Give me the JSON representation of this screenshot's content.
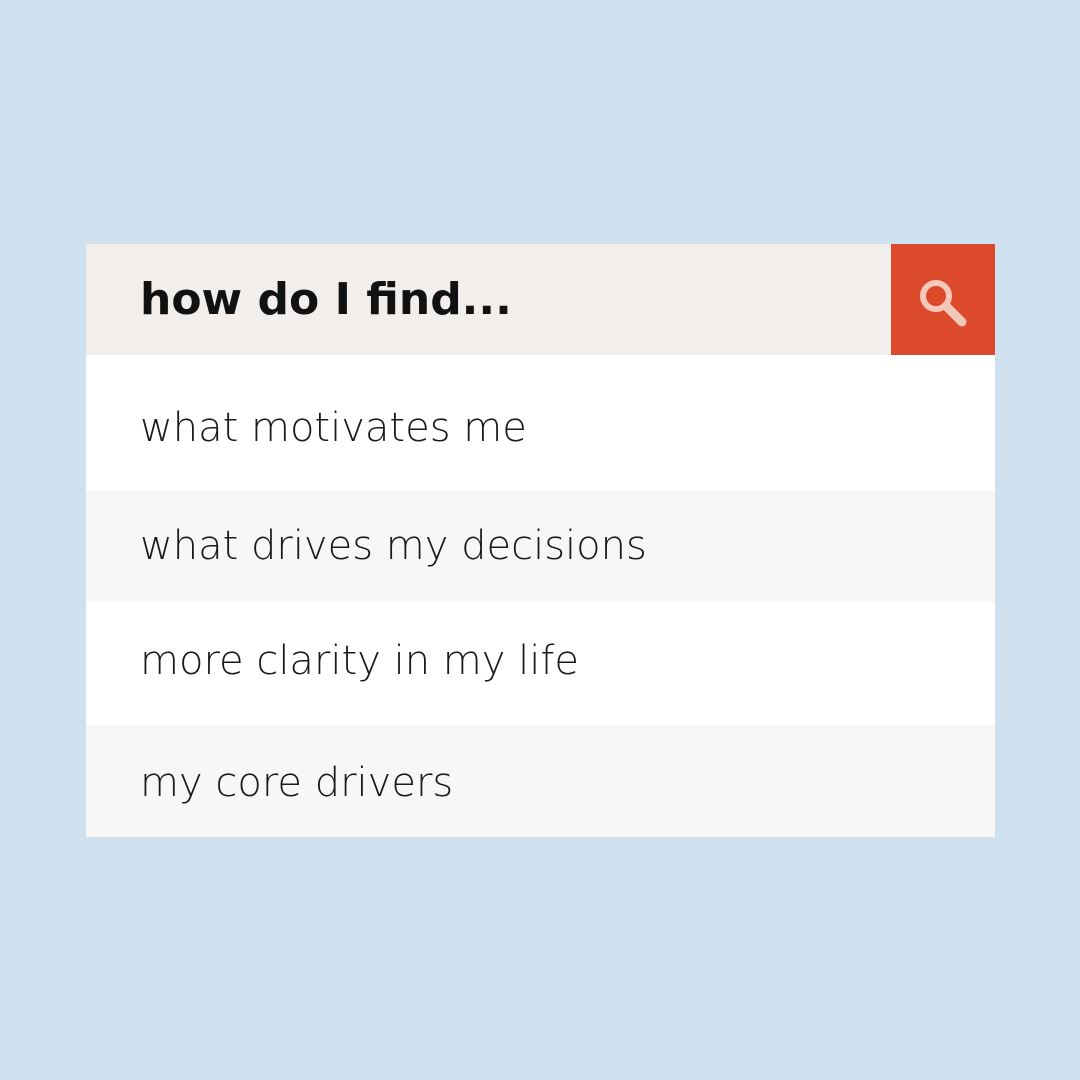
{
  "search": {
    "query": "how do I find...",
    "button_icon": "magnifier-icon",
    "button_color": "#dc4a2b"
  },
  "suggestions": [
    {
      "label": "what motivates me"
    },
    {
      "label": "what drives my decisions"
    },
    {
      "label": "more clarity in my life"
    },
    {
      "label": "my core drivers"
    }
  ],
  "colors": {
    "background": "#cfe0ef",
    "search_bar": "#f2eeec",
    "accent": "#dc4a2b",
    "icon": "#f6c8bb"
  }
}
